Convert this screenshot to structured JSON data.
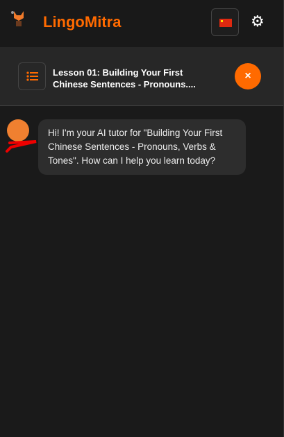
{
  "header": {
    "brand": "LingoMitra",
    "language_flag": "china-flag-icon",
    "settings_icon": "gear-icon"
  },
  "lesson": {
    "title": "Lesson 01: Building Your First Chinese Sentences - Pronouns....",
    "close_label": "×"
  },
  "chat": {
    "messages": [
      {
        "sender": "tutor",
        "text": "Hi! I'm your AI tutor for \"Building Your First Chinese Sentences - Pronouns, Verbs & Tones\". How can I help you learn today?"
      }
    ]
  },
  "colors": {
    "accent": "#ff6a00",
    "background": "#1a1a1a"
  }
}
